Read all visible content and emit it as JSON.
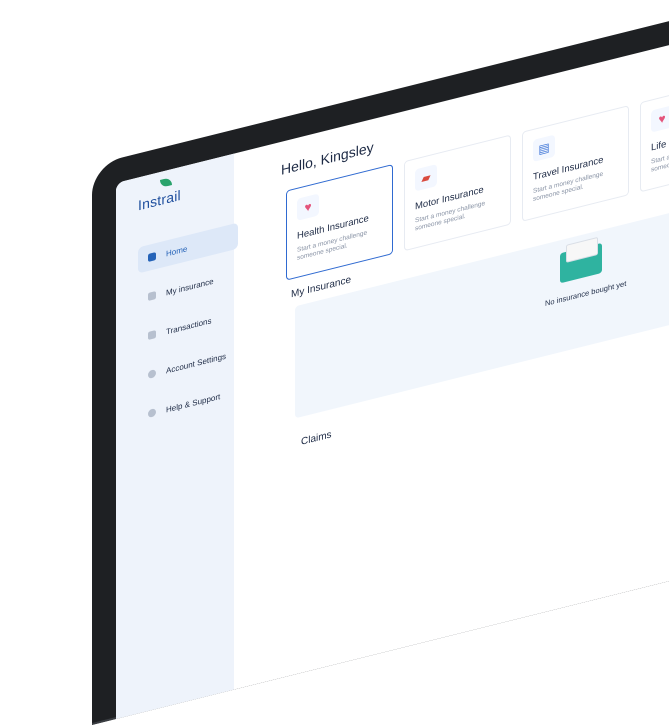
{
  "app": {
    "name": "Instrail"
  },
  "sidebar": {
    "items": [
      {
        "label": "Home",
        "active": true,
        "icon": "home-icon"
      },
      {
        "label": "My insurance",
        "active": false,
        "icon": "file-icon"
      },
      {
        "label": "Transactions",
        "active": false,
        "icon": "receipt-icon"
      },
      {
        "label": "Account Settings",
        "active": false,
        "icon": "user-icon"
      },
      {
        "label": "Help & Support",
        "active": false,
        "icon": "help-icon"
      }
    ]
  },
  "main": {
    "greeting": "Hello, Kingsley",
    "cards": [
      {
        "title": "Health Insurance",
        "desc": "Start a money challenge someone special.",
        "icon": "health-icon",
        "selected": true
      },
      {
        "title": "Motor Insurance",
        "desc": "Start a money challenge someone special.",
        "icon": "car-icon",
        "selected": false
      },
      {
        "title": "Travel Insurance",
        "desc": "Start a money challenge someone special.",
        "icon": "suitcase-icon",
        "selected": false
      },
      {
        "title": "Life Insurance",
        "desc": "Start a money challenge someone special.",
        "icon": "heart-icon",
        "selected": false
      }
    ],
    "my_insurance": {
      "title": "My Insurance",
      "empty_text": "No insurance bought yet"
    },
    "claims": {
      "title": "Claims"
    }
  },
  "colors": {
    "accent": "#2563b8",
    "sidebar_bg": "#eef3fb",
    "teal": "#2fb3a0"
  }
}
